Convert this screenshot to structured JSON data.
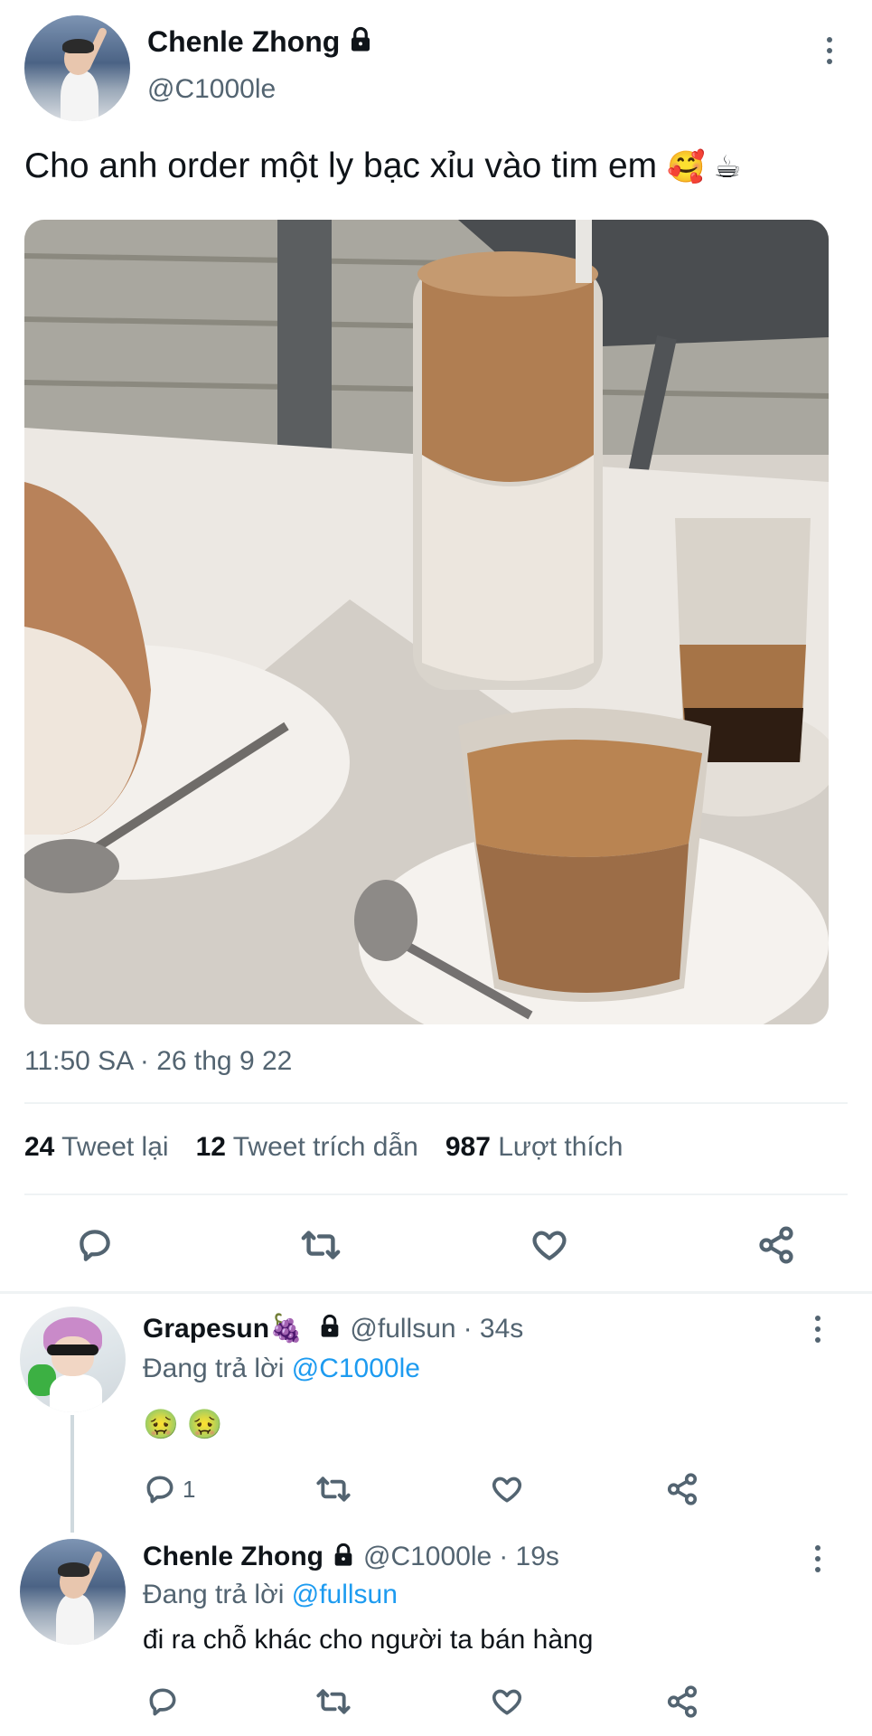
{
  "tweet": {
    "author_name": "Chenle Zhong",
    "handle": "@C1000le",
    "text": "Cho anh order một ly bạc xỉu vào tim em",
    "text_emoji": "🥰 ☕",
    "timestamp": "11:50 SA · 26 thg 9 22",
    "stats": {
      "retweets_count": "24",
      "retweets_label": "Tweet lại",
      "quotes_count": "12",
      "quotes_label": "Tweet trích dẫn",
      "likes_count": "987",
      "likes_label": "Lượt thích"
    },
    "icons": [
      "reply-icon",
      "retweet-icon",
      "like-icon",
      "share-icon"
    ]
  },
  "replies": [
    {
      "author_name": "Grapesun🍇",
      "handle": "@fullsun",
      "time": "· 34s",
      "replying_label": "Đang trả lời",
      "replying_to": "@C1000le",
      "text": "🤢 🤢",
      "reply_count": "1"
    },
    {
      "author_name": "Chenle Zhong",
      "handle": "@C1000le",
      "time": "· 19s",
      "replying_label": "Đang trả lời",
      "replying_to": "@fullsun",
      "text": "đi ra chỗ khác cho người ta bán hàng",
      "reply_count": ""
    }
  ],
  "colors": {
    "accent": "#1d9bf0",
    "muted": "#536471",
    "text": "#0f1419",
    "divider": "#eff3f4"
  }
}
